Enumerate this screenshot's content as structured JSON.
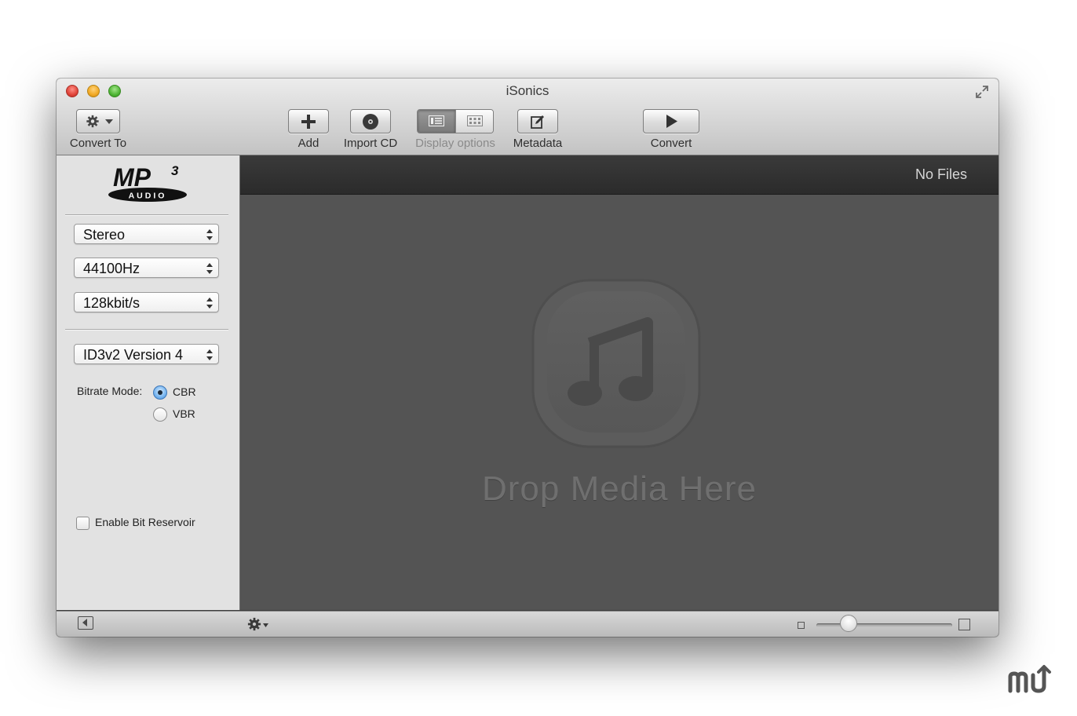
{
  "window": {
    "title": "iSonics"
  },
  "toolbar": {
    "convert_to_label": "Convert To",
    "add_label": "Add",
    "import_cd_label": "Import CD",
    "display_options_label": "Display options",
    "metadata_label": "Metadata",
    "convert_label": "Convert",
    "display_options_selected": "list"
  },
  "sidebar": {
    "format_logo_text": "MP",
    "format_logo_superscript": "3",
    "format_logo_subtext": "AUDIO",
    "channels_value": "Stereo",
    "sample_rate_value": "44100Hz",
    "bitrate_value": "128kbit/s",
    "id3_version_value": "ID3v2 Version 4",
    "bitrate_mode_label": "Bitrate Mode:",
    "bitrate_modes": [
      {
        "label": "CBR",
        "selected": true
      },
      {
        "label": "VBR",
        "selected": false
      }
    ],
    "bit_reservoir_label": "Enable Bit Reservoir",
    "bit_reservoir_checked": false
  },
  "main": {
    "file_count": "No Files",
    "drop_text": "Drop Media Here"
  },
  "bottombar": {
    "zoom_slider_fraction": 0.2
  },
  "watermark": {
    "text": "mu"
  },
  "colors": {
    "drop_area_bg": "#545454",
    "header_bg": "#2f2f2f",
    "sidebar_bg": "#e2e2e2",
    "radio_selected": "#6fb0ee"
  },
  "icons": [
    "close-icon",
    "minimize-icon",
    "zoom-icon",
    "fullscreen-icon",
    "gear-icon",
    "chevron-down-icon",
    "plus-icon",
    "cd-icon",
    "list-view-icon",
    "grid-view-icon",
    "edit-icon",
    "play-icon",
    "popup-arrows-icon",
    "music-note-icon",
    "sidebar-toggle-icon"
  ]
}
